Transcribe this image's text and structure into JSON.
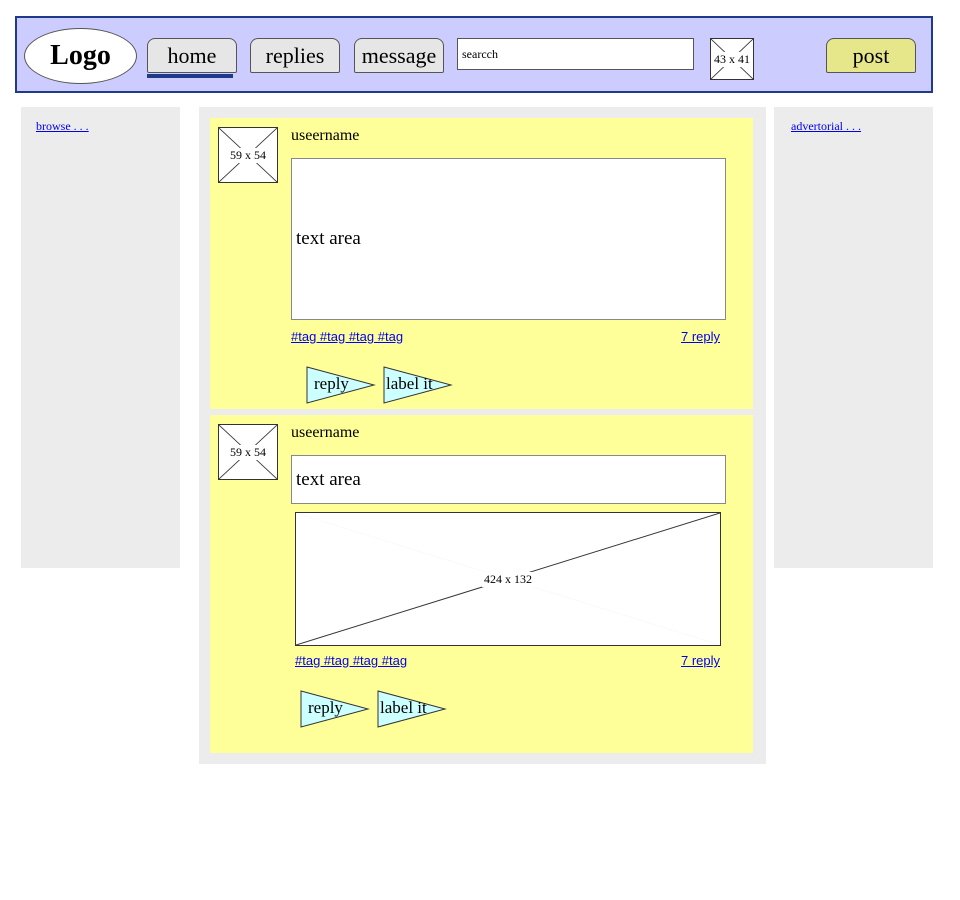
{
  "header": {
    "logo": "Logo",
    "nav": [
      {
        "label": "home",
        "active": true
      },
      {
        "label": "replies"
      },
      {
        "label": "message"
      }
    ],
    "search_value": "searcch",
    "icon_placeholder": "43 x 41",
    "post_label": "post"
  },
  "left_sidebar": {
    "link": "browse . . ."
  },
  "right_sidebar": {
    "link": "advertorial . . ."
  },
  "posts": [
    {
      "avatar": "59 x 54",
      "username": "useername",
      "text": "text area",
      "tags": "#tag #tag #tag #tag",
      "replies": "7 reply",
      "reply_btn": "reply",
      "label_btn": "label it"
    },
    {
      "avatar": "59 x 54",
      "username": "useername",
      "text": "text area",
      "image": "424 x 132",
      "tags": "#tag #tag #tag #tag",
      "replies": "7 reply",
      "reply_btn": "reply",
      "label_btn": "label it"
    }
  ],
  "colors": {
    "header_bg": "#ccccff",
    "header_border": "#1f3a8a",
    "post_bg": "#ffff99",
    "button_bg": "#ccffff"
  }
}
